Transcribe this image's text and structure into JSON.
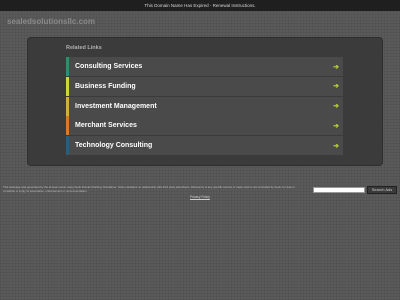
{
  "topbar": {
    "text": "This Domain Name Has Expired - Renewal Instructions."
  },
  "header": {
    "domain": "sealedsolutionsllc.com"
  },
  "panel": {
    "heading": "Related Links",
    "links": [
      {
        "label": "Consulting Services",
        "accent": "#2f8f6a"
      },
      {
        "label": "Business Funding",
        "accent": "#cfd63a"
      },
      {
        "label": "Investment Management",
        "accent": "#c9b33a"
      },
      {
        "label": "Merchant Services",
        "accent": "#d77a2e"
      },
      {
        "label": "Technology Consulting",
        "accent": "#2a5f7a"
      }
    ],
    "arrow_icon": "arrow-right-icon",
    "arrow_color": "#b9cf3f"
  },
  "footer": {
    "disclaimer": "This webpage was generated by the domain owner using Sedo Domain Parking. Disclaimer: Sedo maintains no relationship with third party advertisers. Reference to any specific service or trade mark is not controlled by Sedo nor does it constitute or imply its association, endorsement or recommendation.",
    "privacy_link": "Privacy Policy",
    "search_button": "Search Ads",
    "search_value": ""
  }
}
